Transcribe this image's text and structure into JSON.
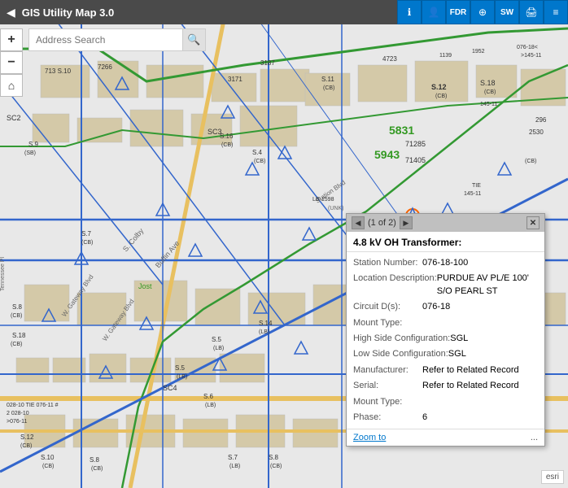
{
  "app": {
    "title": "GIS Utility Map 3.0",
    "back_label": "◀"
  },
  "toolbar": {
    "buttons": [
      {
        "id": "info",
        "icon": "ℹ",
        "label": "info-button"
      },
      {
        "id": "person",
        "icon": "👤",
        "label": "person-button"
      },
      {
        "id": "fdr",
        "icon": "FDR",
        "label": "fdr-button"
      },
      {
        "id": "search",
        "icon": "🔍",
        "label": "search-button"
      },
      {
        "id": "sw",
        "icon": "SW",
        "label": "sw-button"
      },
      {
        "id": "print",
        "icon": "🖨",
        "label": "print-button"
      },
      {
        "id": "layers",
        "icon": "≡",
        "label": "layers-button"
      }
    ]
  },
  "search": {
    "placeholder": "Address Search",
    "current_value": ""
  },
  "zoom": {
    "plus_label": "+",
    "minus_label": "−",
    "home_label": "⌂"
  },
  "popup": {
    "page_indicator": "(1 of 2)",
    "feature_title": "4.8 kV OH Transformer:",
    "fields": [
      {
        "label": "Station Number:",
        "value": "076-18-100"
      },
      {
        "label": "Location Description:",
        "value": "PURDUE AV PL/E 100' S/O PEARL ST"
      },
      {
        "label": "Circuit D(s):",
        "value": "076-18"
      },
      {
        "label": "Mount Type:",
        "value": ""
      },
      {
        "label": "High Side Configuration:",
        "value": "SGL"
      },
      {
        "label": "Low Side Configuration:",
        "value": "SGL"
      },
      {
        "label": "Manufacturer:",
        "value": "Refer to Related Record"
      },
      {
        "label": "Serial:",
        "value": "Refer to Related Record"
      },
      {
        "label": "Mount Type:",
        "value": ""
      },
      {
        "label": "Phase:",
        "value": "6"
      }
    ],
    "zoom_to_label": "Zoom to",
    "more_label": "..."
  },
  "esri": {
    "label": "esri"
  }
}
